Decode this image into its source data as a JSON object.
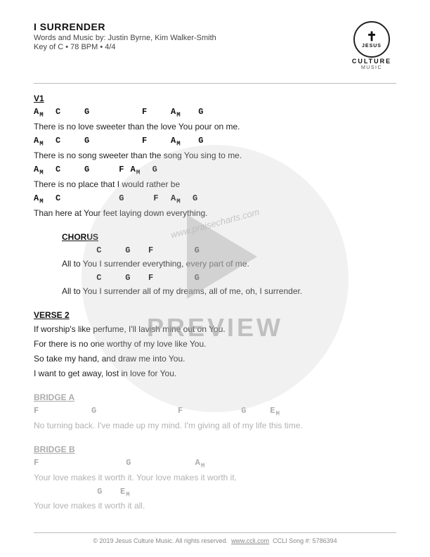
{
  "header": {
    "title": "I SURRENDER",
    "meta": "Words and Music by: Justin Byrne, Kim Walker-Smith",
    "key": "Key of C • 78 BPM • 4/4"
  },
  "logo": {
    "cross": "✝",
    "jesus": "JESUS",
    "culture": "CULTURE",
    "music": "MUSIC"
  },
  "verse1": {
    "label": "V1",
    "lines": [
      {
        "chords": "Am  C    G         F    Am   G",
        "lyric": "There is no love sweeter than the love You pour on me."
      },
      {
        "chords": "Am  C    G         F    Am   G",
        "lyric": "There is no song sweeter than the song You sing to me."
      },
      {
        "chords": "Am  C    G     F Am  G",
        "lyric": "There is no place that I would rather be"
      },
      {
        "chords": "Am  C          G     F  Am  G",
        "lyric": "Than here at Your feet laying down everything."
      }
    ]
  },
  "chorus": {
    "label": "CHORUS",
    "lines": [
      {
        "chords": "     C    G   F       G",
        "lyric": "All to You I surrender everything, every part of me."
      },
      {
        "chords": "     C    G   F       G",
        "lyric": "All to You I surrender all of my dreams, all of me, oh, I surrender."
      }
    ]
  },
  "verse2": {
    "label": "VERSE 2",
    "lines": [
      {
        "chords": "",
        "lyric": "If worship's like perfume, I'll lavish mine out on You."
      },
      {
        "chords": "",
        "lyric": "For there is no one worthy of my love like You."
      },
      {
        "chords": "",
        "lyric": "So take my hand, and draw me into You."
      },
      {
        "chords": "",
        "lyric": "I want to get away, lost in love for You."
      }
    ]
  },
  "bridgeA": {
    "label": "BRIDGE A",
    "lines": [
      {
        "chords": "F         G              F          G    Em",
        "lyric": "No turning back. I've made up my mind. I'm giving all of my life this time."
      }
    ]
  },
  "bridgeB": {
    "label": "BRIDGE B",
    "lines": [
      {
        "chords": "F               G           Am",
        "lyric": "Your love makes it worth it. Your love makes it worth it."
      },
      {
        "chords": "           G    Em",
        "lyric": "Your love makes it worth it all."
      }
    ]
  },
  "preview": {
    "text": "PREVIEW",
    "watermark": "www.praisecharts.com"
  },
  "footer": {
    "copyright": "© 2019 Jesus Culture Music. All rights reserved.",
    "website": "www.ccli.com",
    "ccli": "CCLI Song #: 5786394"
  }
}
